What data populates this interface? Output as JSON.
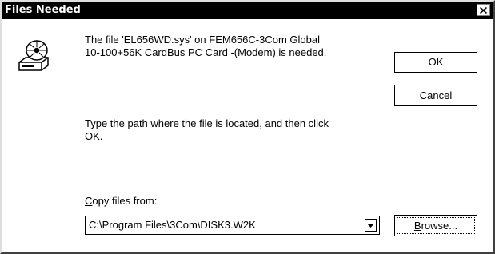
{
  "window": {
    "title": "Files Needed",
    "close_glyph": "✕"
  },
  "icon": {
    "name": "disk-drive-cd-icon"
  },
  "message": {
    "line1": "The file 'EL656WD.sys' on FEM656C-3Com Global",
    "line2": "10-100+56K CardBus PC Card -(Modem) is needed."
  },
  "instruction": {
    "line1": "Type the path where the file is located, and then click",
    "line2": "OK."
  },
  "copy_from": {
    "label_mnemonic": "C",
    "label_rest": "opy files from:",
    "value": "C:\\Program Files\\3Com\\DISK3.W2K"
  },
  "buttons": {
    "ok_label": "OK",
    "cancel_label": "Cancel",
    "browse_mnemonic": "B",
    "browse_rest": "rowse..."
  },
  "colors": {
    "titlebar": "#000000",
    "background": "#ffffff"
  }
}
